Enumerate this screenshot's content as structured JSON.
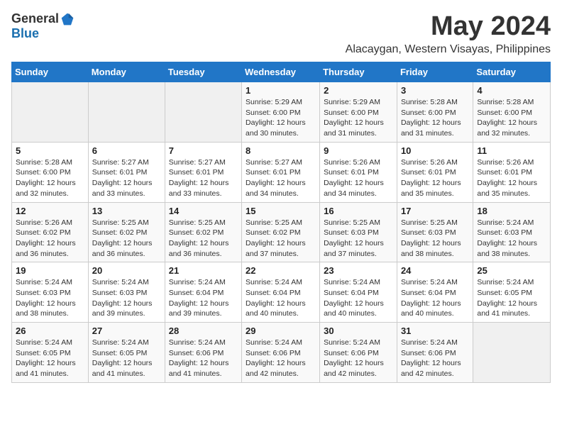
{
  "header": {
    "logo_general": "General",
    "logo_blue": "Blue",
    "month_title": "May 2024",
    "subtitle": "Alacaygan, Western Visayas, Philippines"
  },
  "days_of_week": [
    "Sunday",
    "Monday",
    "Tuesday",
    "Wednesday",
    "Thursday",
    "Friday",
    "Saturday"
  ],
  "weeks": [
    [
      {
        "day": "",
        "info": ""
      },
      {
        "day": "",
        "info": ""
      },
      {
        "day": "",
        "info": ""
      },
      {
        "day": "1",
        "info": "Sunrise: 5:29 AM\nSunset: 6:00 PM\nDaylight: 12 hours\nand 30 minutes."
      },
      {
        "day": "2",
        "info": "Sunrise: 5:29 AM\nSunset: 6:00 PM\nDaylight: 12 hours\nand 31 minutes."
      },
      {
        "day": "3",
        "info": "Sunrise: 5:28 AM\nSunset: 6:00 PM\nDaylight: 12 hours\nand 31 minutes."
      },
      {
        "day": "4",
        "info": "Sunrise: 5:28 AM\nSunset: 6:00 PM\nDaylight: 12 hours\nand 32 minutes."
      }
    ],
    [
      {
        "day": "5",
        "info": "Sunrise: 5:28 AM\nSunset: 6:00 PM\nDaylight: 12 hours\nand 32 minutes."
      },
      {
        "day": "6",
        "info": "Sunrise: 5:27 AM\nSunset: 6:01 PM\nDaylight: 12 hours\nand 33 minutes."
      },
      {
        "day": "7",
        "info": "Sunrise: 5:27 AM\nSunset: 6:01 PM\nDaylight: 12 hours\nand 33 minutes."
      },
      {
        "day": "8",
        "info": "Sunrise: 5:27 AM\nSunset: 6:01 PM\nDaylight: 12 hours\nand 34 minutes."
      },
      {
        "day": "9",
        "info": "Sunrise: 5:26 AM\nSunset: 6:01 PM\nDaylight: 12 hours\nand 34 minutes."
      },
      {
        "day": "10",
        "info": "Sunrise: 5:26 AM\nSunset: 6:01 PM\nDaylight: 12 hours\nand 35 minutes."
      },
      {
        "day": "11",
        "info": "Sunrise: 5:26 AM\nSunset: 6:01 PM\nDaylight: 12 hours\nand 35 minutes."
      }
    ],
    [
      {
        "day": "12",
        "info": "Sunrise: 5:26 AM\nSunset: 6:02 PM\nDaylight: 12 hours\nand 36 minutes."
      },
      {
        "day": "13",
        "info": "Sunrise: 5:25 AM\nSunset: 6:02 PM\nDaylight: 12 hours\nand 36 minutes."
      },
      {
        "day": "14",
        "info": "Sunrise: 5:25 AM\nSunset: 6:02 PM\nDaylight: 12 hours\nand 36 minutes."
      },
      {
        "day": "15",
        "info": "Sunrise: 5:25 AM\nSunset: 6:02 PM\nDaylight: 12 hours\nand 37 minutes."
      },
      {
        "day": "16",
        "info": "Sunrise: 5:25 AM\nSunset: 6:03 PM\nDaylight: 12 hours\nand 37 minutes."
      },
      {
        "day": "17",
        "info": "Sunrise: 5:25 AM\nSunset: 6:03 PM\nDaylight: 12 hours\nand 38 minutes."
      },
      {
        "day": "18",
        "info": "Sunrise: 5:24 AM\nSunset: 6:03 PM\nDaylight: 12 hours\nand 38 minutes."
      }
    ],
    [
      {
        "day": "19",
        "info": "Sunrise: 5:24 AM\nSunset: 6:03 PM\nDaylight: 12 hours\nand 38 minutes."
      },
      {
        "day": "20",
        "info": "Sunrise: 5:24 AM\nSunset: 6:03 PM\nDaylight: 12 hours\nand 39 minutes."
      },
      {
        "day": "21",
        "info": "Sunrise: 5:24 AM\nSunset: 6:04 PM\nDaylight: 12 hours\nand 39 minutes."
      },
      {
        "day": "22",
        "info": "Sunrise: 5:24 AM\nSunset: 6:04 PM\nDaylight: 12 hours\nand 40 minutes."
      },
      {
        "day": "23",
        "info": "Sunrise: 5:24 AM\nSunset: 6:04 PM\nDaylight: 12 hours\nand 40 minutes."
      },
      {
        "day": "24",
        "info": "Sunrise: 5:24 AM\nSunset: 6:04 PM\nDaylight: 12 hours\nand 40 minutes."
      },
      {
        "day": "25",
        "info": "Sunrise: 5:24 AM\nSunset: 6:05 PM\nDaylight: 12 hours\nand 41 minutes."
      }
    ],
    [
      {
        "day": "26",
        "info": "Sunrise: 5:24 AM\nSunset: 6:05 PM\nDaylight: 12 hours\nand 41 minutes."
      },
      {
        "day": "27",
        "info": "Sunrise: 5:24 AM\nSunset: 6:05 PM\nDaylight: 12 hours\nand 41 minutes."
      },
      {
        "day": "28",
        "info": "Sunrise: 5:24 AM\nSunset: 6:06 PM\nDaylight: 12 hours\nand 41 minutes."
      },
      {
        "day": "29",
        "info": "Sunrise: 5:24 AM\nSunset: 6:06 PM\nDaylight: 12 hours\nand 42 minutes."
      },
      {
        "day": "30",
        "info": "Sunrise: 5:24 AM\nSunset: 6:06 PM\nDaylight: 12 hours\nand 42 minutes."
      },
      {
        "day": "31",
        "info": "Sunrise: 5:24 AM\nSunset: 6:06 PM\nDaylight: 12 hours\nand 42 minutes."
      },
      {
        "day": "",
        "info": ""
      }
    ]
  ]
}
